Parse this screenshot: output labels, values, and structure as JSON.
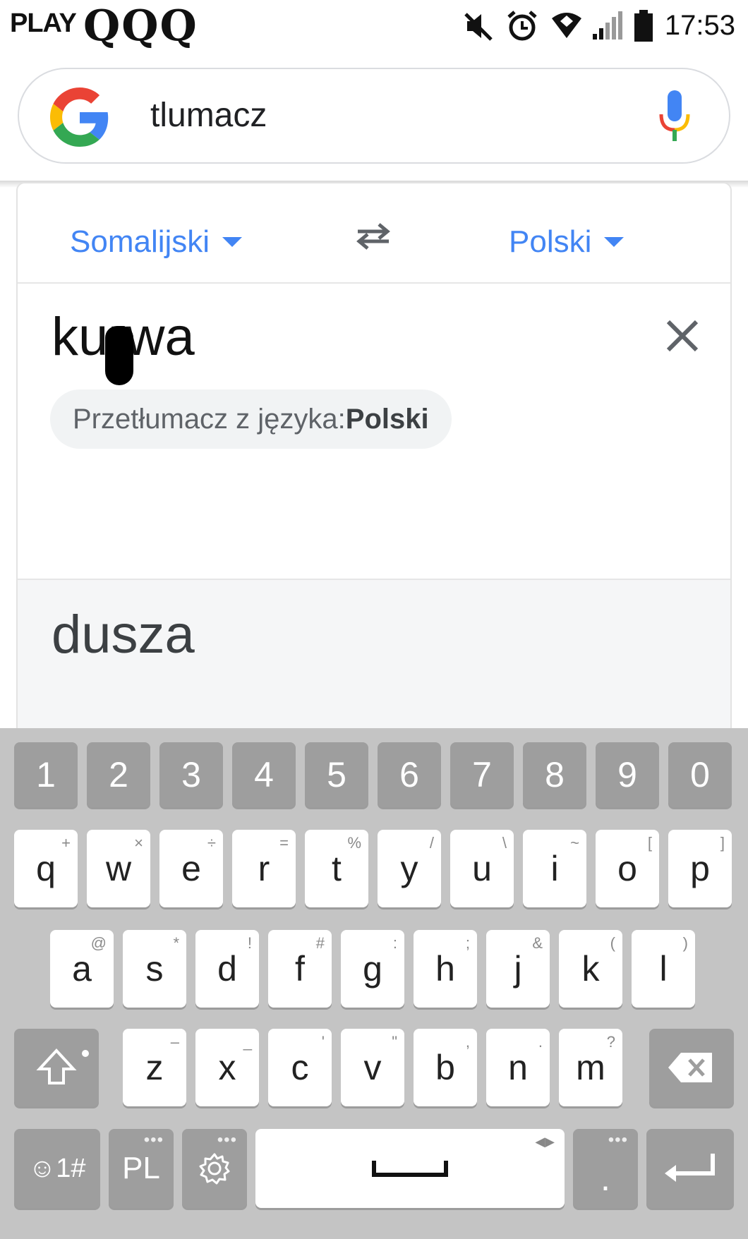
{
  "status_bar": {
    "carrier": "PLAY",
    "carrier_icons": "QQQ",
    "icons": [
      "mute-icon",
      "alarm-icon",
      "wifi-icon",
      "signal-icon",
      "battery-icon"
    ],
    "time": "17:53"
  },
  "search": {
    "query": "tlumacz",
    "logo": "google-g-icon",
    "voice_icon": "microphone-icon"
  },
  "translate": {
    "source_language": "Somalijski",
    "target_language": "Polski",
    "input_text": "kurwa",
    "detect_prefix": "Przetłumacz z języka:",
    "detect_language": "Polski",
    "output_text": "dusza"
  },
  "colors": {
    "accent": "#4285f4",
    "keyboard_bg": "#c4c4c4",
    "key_dark": "#9e9e9e",
    "key_light": "#ffffff"
  },
  "keyboard": {
    "number_row": [
      "1",
      "2",
      "3",
      "4",
      "5",
      "6",
      "7",
      "8",
      "9",
      "0"
    ],
    "row1": [
      {
        "k": "q",
        "h": "+"
      },
      {
        "k": "w",
        "h": "×"
      },
      {
        "k": "e",
        "h": "÷"
      },
      {
        "k": "r",
        "h": "="
      },
      {
        "k": "t",
        "h": "%"
      },
      {
        "k": "y",
        "h": "/"
      },
      {
        "k": "u",
        "h": "\\"
      },
      {
        "k": "i",
        "h": "~"
      },
      {
        "k": "o",
        "h": "["
      },
      {
        "k": "p",
        "h": "]"
      }
    ],
    "row2": [
      {
        "k": "a",
        "h": "@"
      },
      {
        "k": "s",
        "h": "*"
      },
      {
        "k": "d",
        "h": "!"
      },
      {
        "k": "f",
        "h": "#"
      },
      {
        "k": "g",
        "h": ":"
      },
      {
        "k": "h",
        "h": ";"
      },
      {
        "k": "j",
        "h": "&"
      },
      {
        "k": "k",
        "h": "("
      },
      {
        "k": "l",
        "h": ")"
      }
    ],
    "row3": [
      {
        "k": "z",
        "h": "–"
      },
      {
        "k": "x",
        "h": "_"
      },
      {
        "k": "c",
        "h": "'"
      },
      {
        "k": "v",
        "h": "\""
      },
      {
        "k": "b",
        "h": ","
      },
      {
        "k": "n",
        "h": "."
      },
      {
        "k": "m",
        "h": "?"
      }
    ],
    "symbols_label": "☺1#",
    "language_label": "PL",
    "period_label": "."
  }
}
